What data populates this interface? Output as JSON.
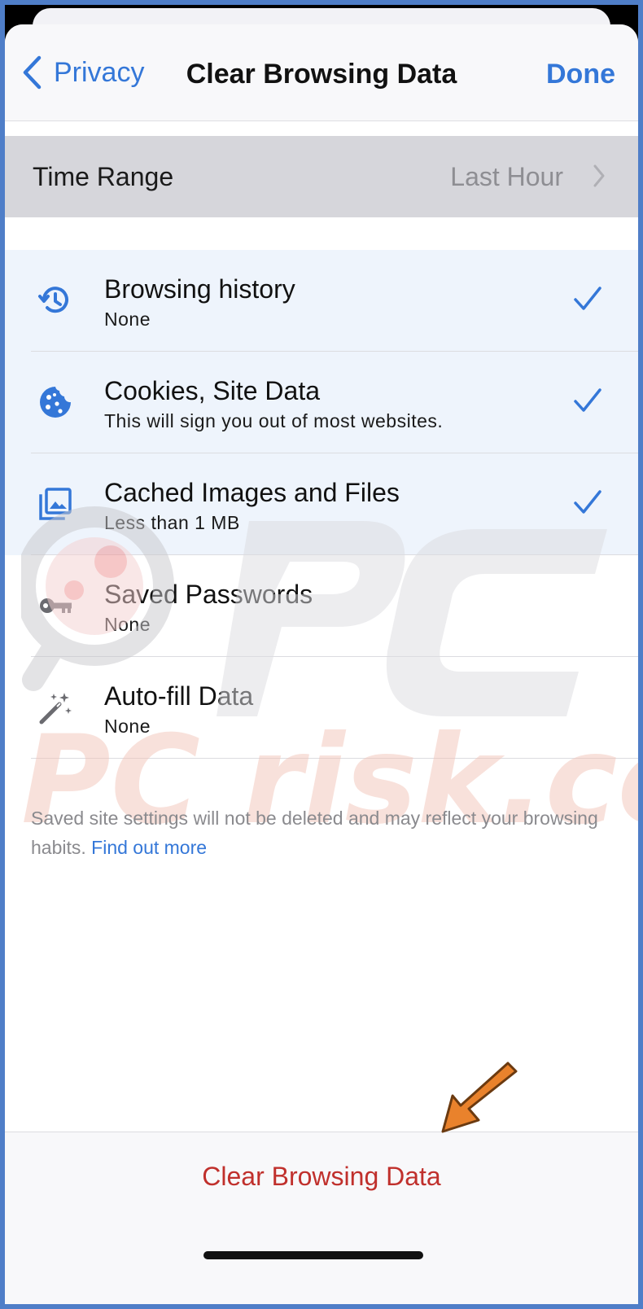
{
  "nav": {
    "back_label": "Privacy",
    "title": "Clear Browsing Data",
    "done_label": "Done"
  },
  "time_range": {
    "label": "Time Range",
    "value": "Last Hour"
  },
  "items": [
    {
      "title": "Browsing history",
      "subtitle": "None",
      "checked": true,
      "icon": "history-icon"
    },
    {
      "title": "Cookies, Site Data",
      "subtitle": "This will sign you out of most websites.",
      "checked": true,
      "icon": "cookie-icon"
    },
    {
      "title": "Cached Images and Files",
      "subtitle": "Less than 1 MB",
      "checked": true,
      "icon": "image-icon"
    },
    {
      "title": "Saved Passwords",
      "subtitle": "None",
      "checked": false,
      "icon": "key-icon"
    },
    {
      "title": "Auto-fill Data",
      "subtitle": "None",
      "checked": false,
      "icon": "magic-wand-icon"
    }
  ],
  "footnote": {
    "text": "Saved site settings will not be deleted and may reflect your browsing habits. ",
    "link": "Find out more"
  },
  "watermark_text": "PC risk.com",
  "bottom": {
    "clear_label": "Clear Browsing Data"
  },
  "colors": {
    "accent": "#3477d8",
    "destructive": "#c0302c",
    "selected_bg": "#eef4fc",
    "annotation_arrow": "#e9822c"
  }
}
